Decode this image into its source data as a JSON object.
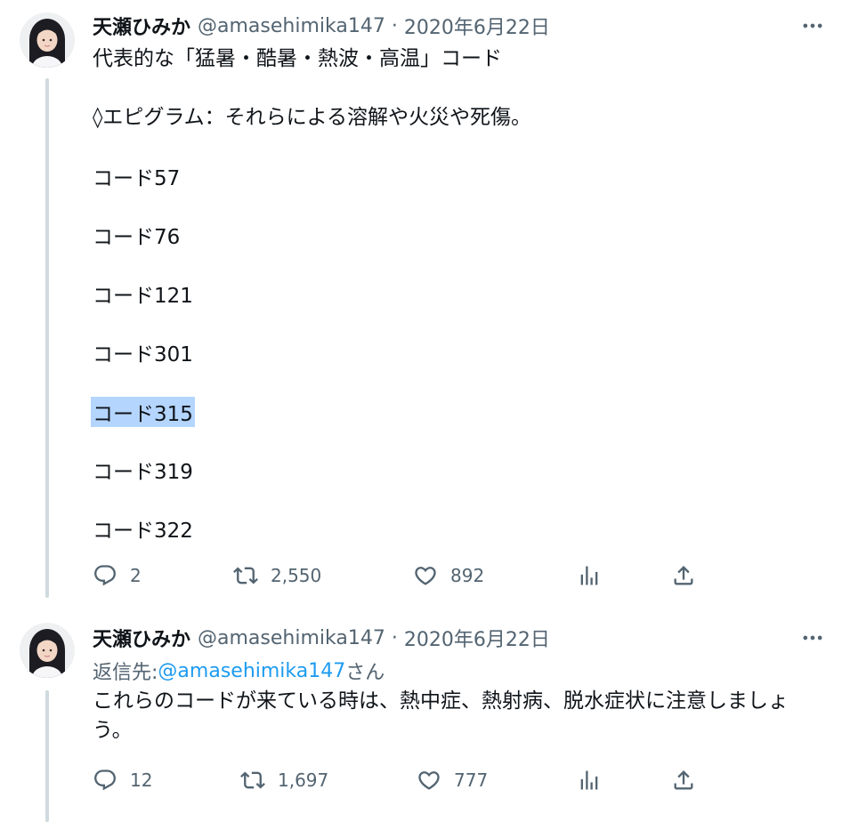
{
  "tweets": [
    {
      "author": "天瀬ひみか",
      "handle": "@amasehimika147",
      "sep": "·",
      "date": "2020年6月22日",
      "lines": [
        "代表的な「猛暑・酷暑・熱波・高温」コード",
        "◊エピグラム：それらによる溶解や火災や死傷。"
      ],
      "codes": [
        "コード57",
        "コード76",
        "コード121",
        "コード301",
        "コード315",
        "コード319",
        "コード322"
      ],
      "highlighted_code": "コード315",
      "replies": "2",
      "retweets": "2,550",
      "likes": "892"
    },
    {
      "author": "天瀬ひみか",
      "handle": "@amasehimika147",
      "sep": "·",
      "date": "2020年6月22日",
      "replying_prefix": "返信先: ",
      "replying_mention": "@amasehimika147",
      "replying_suffix": "さん",
      "text": "これらのコードが来ている時は、熱中症、熱射病、脱水症状に注意しましょう。",
      "replies": "12",
      "retweets": "1,697",
      "likes": "777"
    }
  ],
  "icons": {
    "reply": "reply-icon",
    "retweet": "retweet-icon",
    "like": "heart-icon",
    "views": "analytics-icon",
    "share": "share-icon",
    "more": "more-icon"
  },
  "colors": {
    "text": "#0f1419",
    "secondary": "#536471",
    "link": "#1d9bf0",
    "selection": "#b4d5fe",
    "thread_line": "#cfd9de"
  }
}
